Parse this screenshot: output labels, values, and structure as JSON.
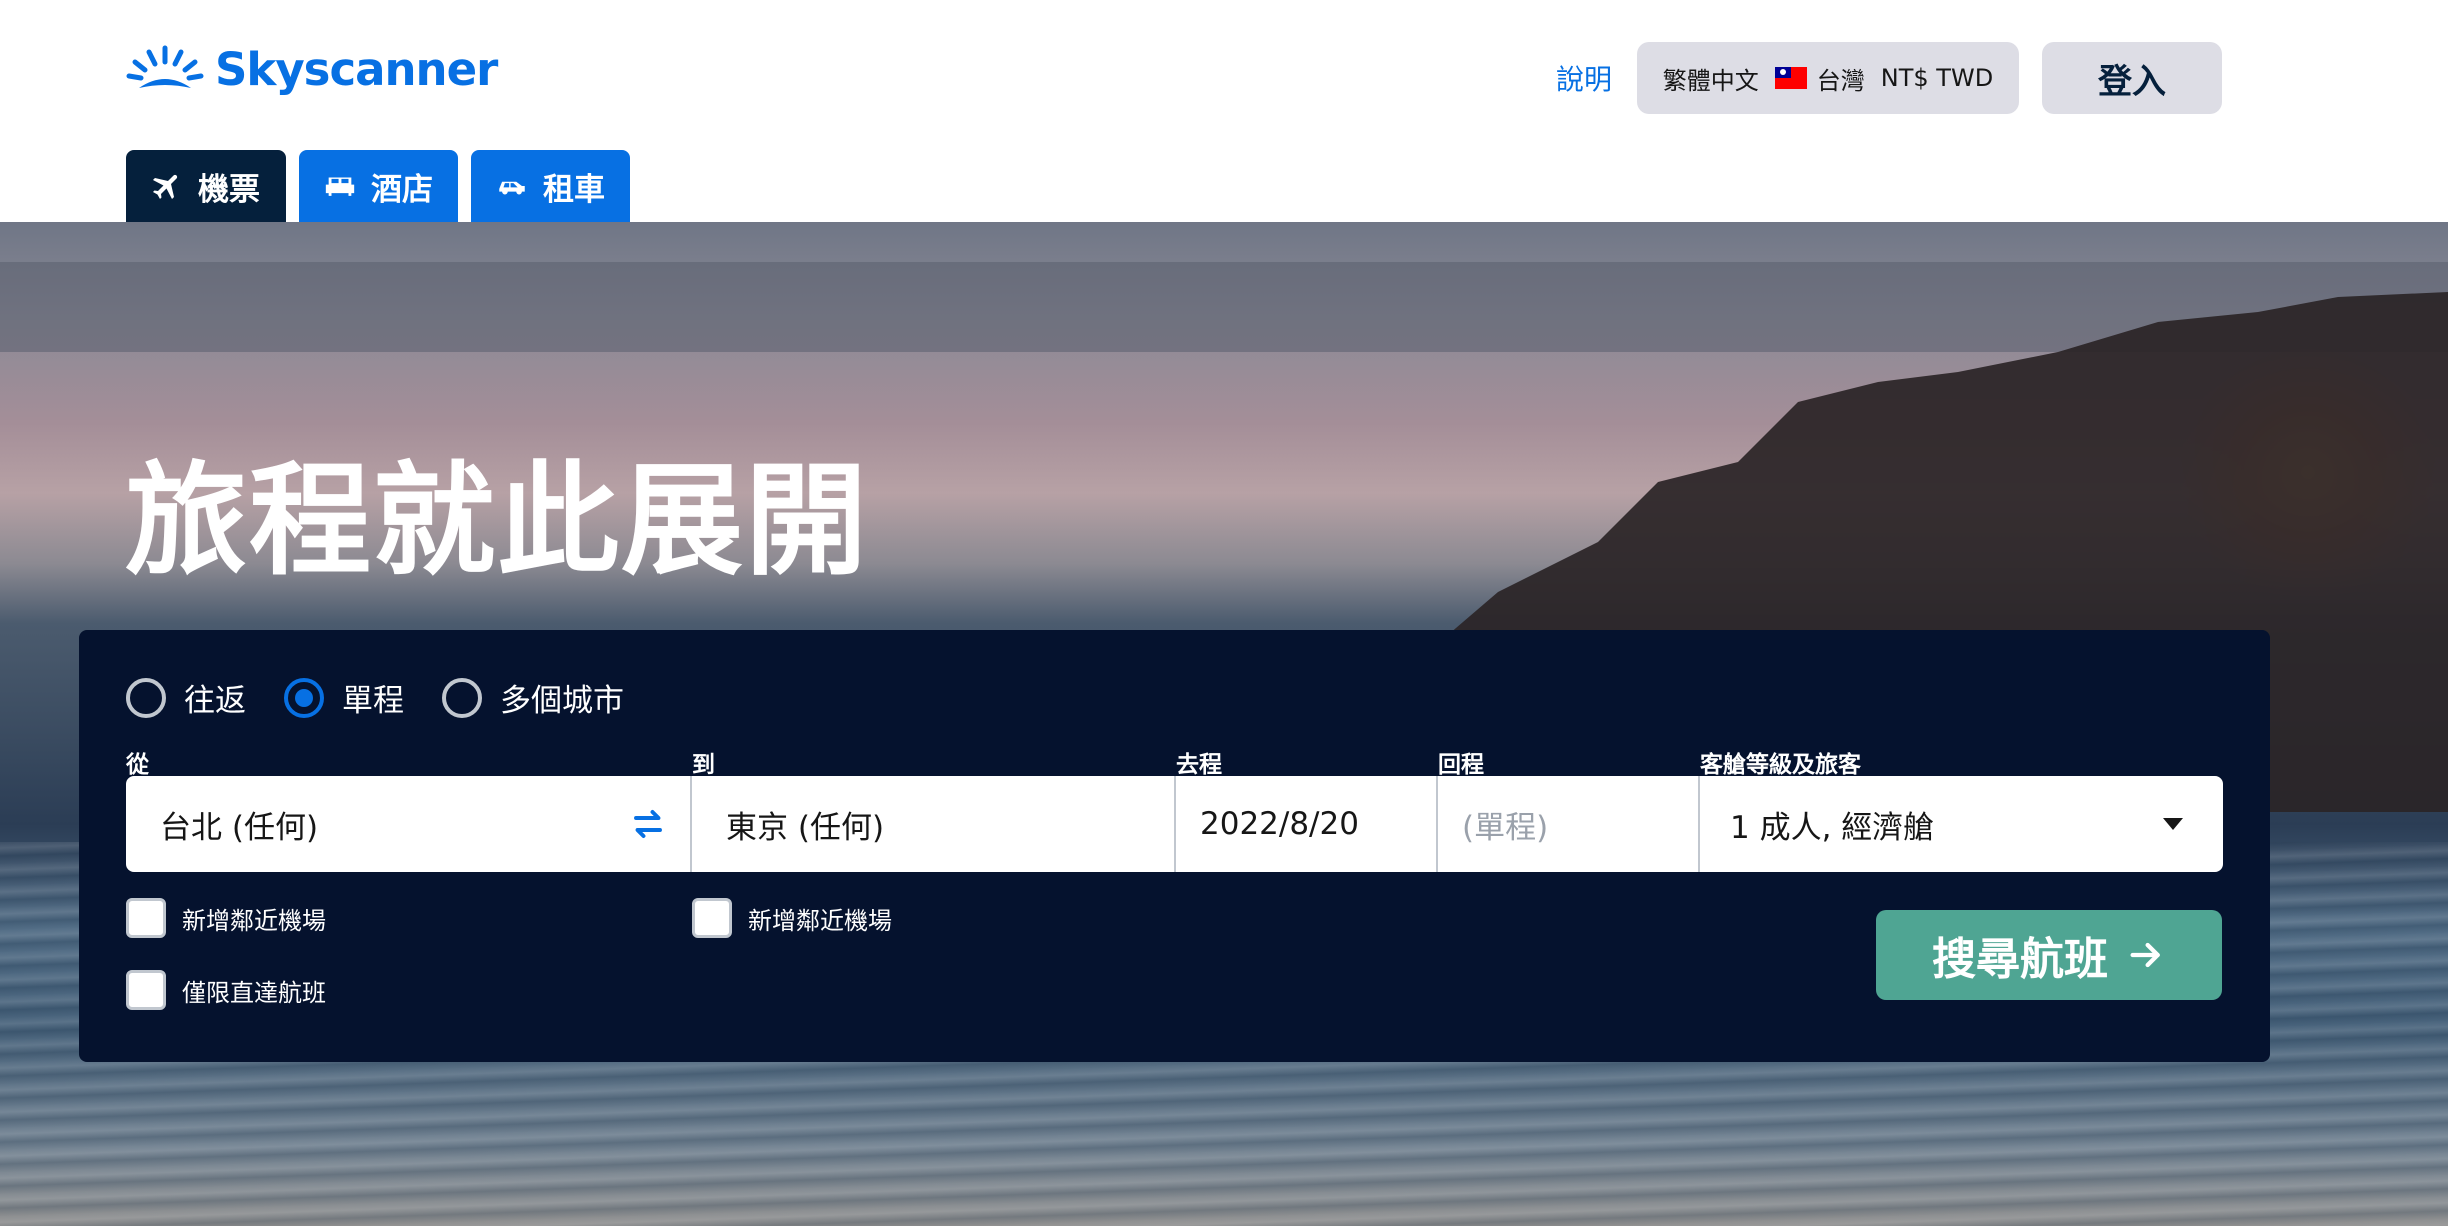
{
  "header": {
    "logo_text": "Skyscanner",
    "help": "說明",
    "locale": {
      "language": "繁體中文",
      "country": "台灣",
      "currency": "NT$ TWD"
    },
    "login": "登入"
  },
  "tabs": [
    {
      "label": "機票",
      "icon": "plane-icon",
      "active": true
    },
    {
      "label": "酒店",
      "icon": "bed-icon",
      "active": false
    },
    {
      "label": "租車",
      "icon": "car-icon",
      "active": false
    }
  ],
  "hero": {
    "title": "旅程就此展開"
  },
  "search": {
    "trip_types": [
      {
        "label": "往返",
        "checked": false
      },
      {
        "label": "單程",
        "checked": true
      },
      {
        "label": "多個城市",
        "checked": false
      }
    ],
    "labels": {
      "from": "從",
      "to": "到",
      "depart": "去程",
      "return": "回程",
      "travellers": "客艙等級及旅客"
    },
    "values": {
      "from": "台北 (任何)",
      "to": "東京 (任何)",
      "depart": "2022/8/20",
      "return": "(單程)",
      "travellers": "1 成人, 經濟艙"
    },
    "options": {
      "nearby_from": "新增鄰近機場",
      "nearby_to": "新增鄰近機場",
      "direct_only": "僅限直達航班"
    },
    "button": "搜尋航班"
  },
  "colors": {
    "brand_blue": "#0770e3",
    "panel_navy": "#05122e",
    "search_green": "#4fa593"
  }
}
